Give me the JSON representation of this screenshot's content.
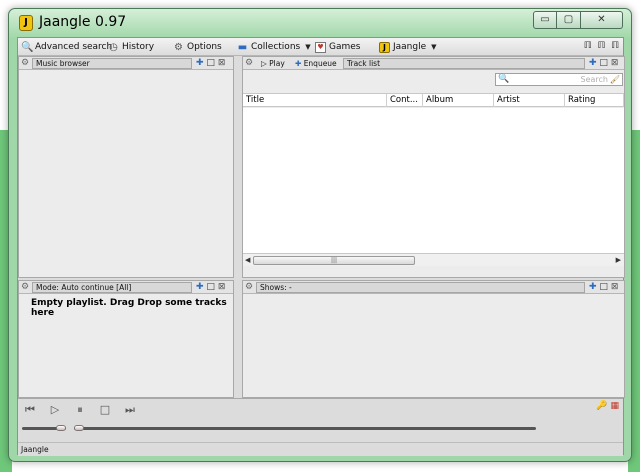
{
  "window": {
    "title": "Jaangle 0.97",
    "app_icon": "jaangle-icon",
    "controls": {
      "minimize": "▭",
      "maximize": "▢",
      "close": "✕"
    }
  },
  "toolbar": {
    "items": [
      {
        "name": "advanced-search",
        "label": "Advanced search",
        "icon": "🔍",
        "icon_name": "magnifier-icon"
      },
      {
        "name": "history",
        "label": "History",
        "icon": "◷",
        "icon_name": "history-clock-icon"
      },
      {
        "name": "options",
        "label": "Options",
        "icon": "⚙",
        "icon_name": "gear-icon"
      },
      {
        "name": "collections",
        "label": "Collections",
        "icon": "▬",
        "icon_name": "folder-icon"
      },
      {
        "name": "games",
        "label": "Games",
        "icon": "♥",
        "icon_name": "cards-icon"
      },
      {
        "name": "jaangle",
        "label": "Jaangle",
        "icon": "J",
        "icon_name": "jaangle-icon"
      }
    ],
    "dropdown_glyph": "▼",
    "layout_glyph": "ℿ"
  },
  "panels": {
    "music_browser": {
      "header": "Music browser"
    },
    "track_list": {
      "play_label": "Play",
      "enqueue_label": "Enqueue",
      "header": "Track list",
      "search_placeholder": "Search",
      "columns": [
        "Title",
        "Cont...",
        "Album",
        "Artist",
        "Rating"
      ],
      "scroll_thumb_glyph": "|||"
    },
    "playlist": {
      "header": "Mode: Auto continue [All]",
      "empty_message": "Empty playlist. Drag Drop some tracks here"
    },
    "shows": {
      "header": "Shows: -"
    }
  },
  "panel_controls": {
    "add": "✚",
    "maximize": "□",
    "close": "⊠",
    "gear": "⚙"
  },
  "player": {
    "prev": "⏮",
    "play": "▷",
    "pause": "⏸",
    "stop": "□",
    "next": "⏭",
    "volume_level": 0.85,
    "seek_position": 0.0,
    "right_icons": {
      "key": "🔑",
      "grid": "▦"
    }
  },
  "status": {
    "text": "Jaangle"
  },
  "colors": {
    "window_frame": "#9fd7a8",
    "accent_blue": "#2d6cc0",
    "desktop_green": "#6fc77a"
  }
}
